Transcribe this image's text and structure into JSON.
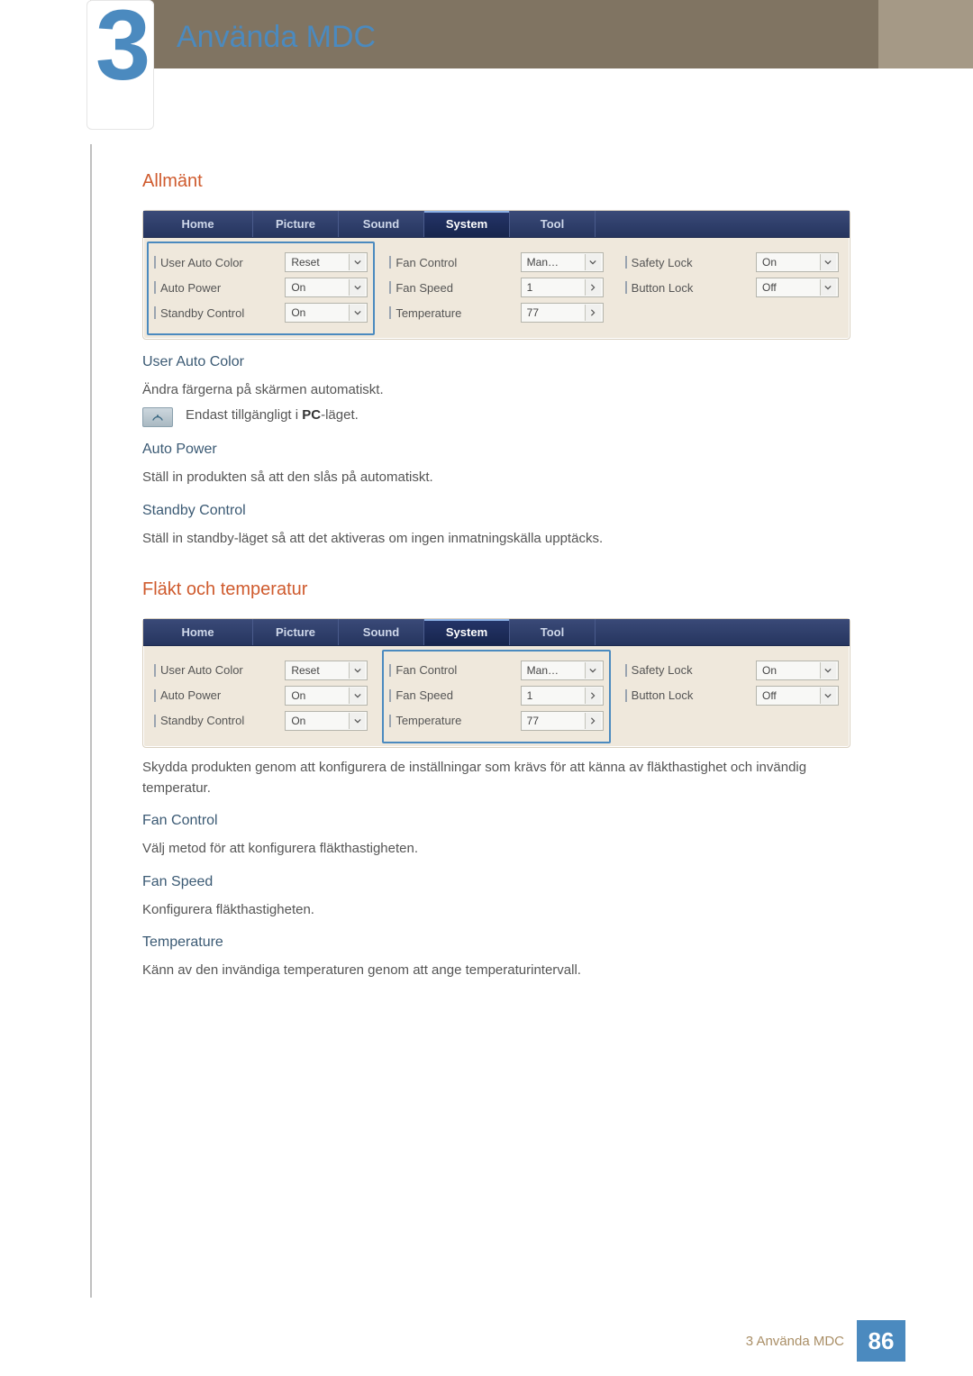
{
  "chapter": {
    "number": "3",
    "title": "Använda MDC"
  },
  "sections": {
    "general": {
      "title": "Allmänt",
      "user_auto_color": {
        "h": "User Auto Color",
        "p": "Ändra färgerna på skärmen automatiskt.",
        "note_pre": "Endast tillgängligt i ",
        "note_bold": "PC",
        "note_post": "-läget."
      },
      "auto_power": {
        "h": "Auto Power",
        "p": "Ställ in produkten så att den slås på automatiskt."
      },
      "standby_control": {
        "h": "Standby Control",
        "p": "Ställ in standby-läget så att det aktiveras om ingen inmatningskälla upptäcks."
      }
    },
    "fan_temp": {
      "title": "Fläkt och temperatur",
      "intro": "Skydda produkten genom att konfigurera de inställningar som krävs för att känna av fläkthastighet och invändig temperatur.",
      "fan_control": {
        "h": "Fan Control",
        "p": "Välj metod för att konfigurera fläkthastigheten."
      },
      "fan_speed": {
        "h": "Fan Speed",
        "p": "Konfigurera fläkthastigheten."
      },
      "temperature": {
        "h": "Temperature",
        "p": "Känn av den invändiga temperaturen genom att ange temperaturintervall."
      }
    }
  },
  "panel": {
    "tabs": [
      "Home",
      "Picture",
      "Sound",
      "System",
      "Tool"
    ],
    "active_tab": "System",
    "col1": [
      {
        "label": "User Auto Color",
        "value": "Reset",
        "kind": "drop"
      },
      {
        "label": "Auto Power",
        "value": "On",
        "kind": "drop"
      },
      {
        "label": "Standby Control",
        "value": "On",
        "kind": "drop"
      }
    ],
    "col2": [
      {
        "label": "Fan Control",
        "value": "Man…",
        "kind": "drop"
      },
      {
        "label": "Fan Speed",
        "value": "1",
        "kind": "spin"
      },
      {
        "label": "Temperature",
        "value": "77",
        "kind": "spin"
      }
    ],
    "col3": [
      {
        "label": "Safety Lock",
        "value": "On",
        "kind": "drop"
      },
      {
        "label": "Button Lock",
        "value": "Off",
        "kind": "drop"
      }
    ]
  },
  "footer": {
    "text": "3 Använda MDC",
    "page": "86"
  }
}
